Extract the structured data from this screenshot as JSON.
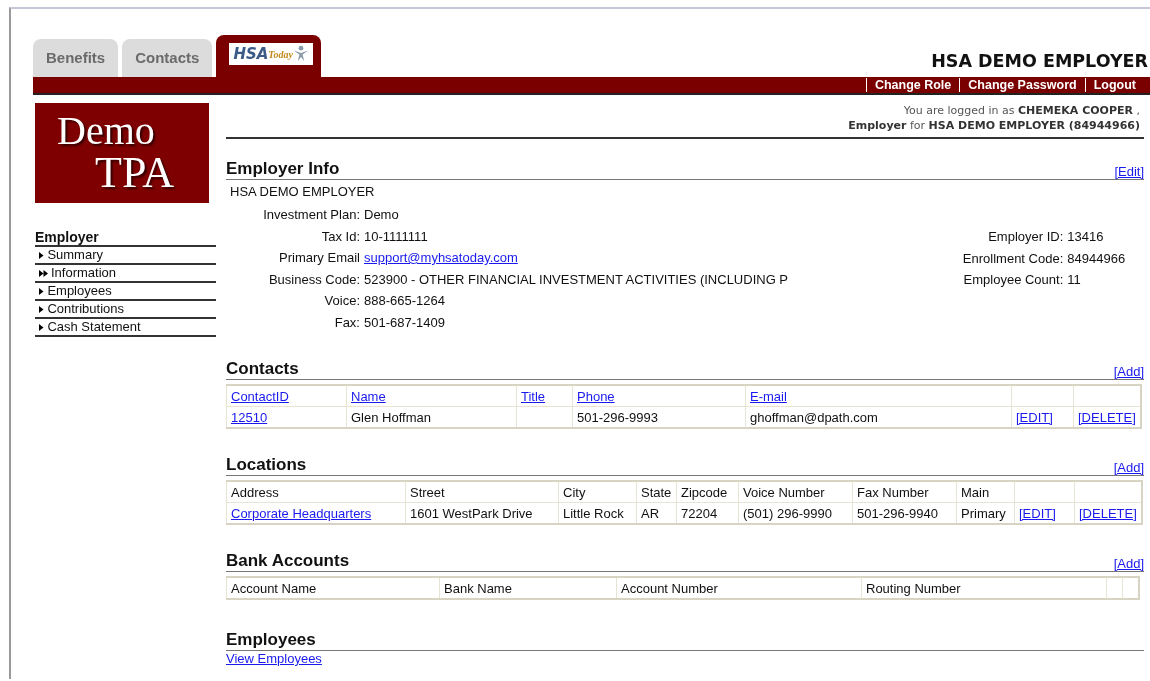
{
  "tabs": [
    {
      "kind": "text",
      "label": "Benefits",
      "selected": false
    },
    {
      "kind": "text",
      "label": "Contacts",
      "selected": false
    },
    {
      "kind": "logo",
      "label": "HSA",
      "sub": "Today",
      "selected": true
    }
  ],
  "employer_title": "HSA DEMO EMPLOYER",
  "top_links": [
    "Change Role",
    "Change Password",
    "Logout"
  ],
  "login_info": [
    "You are logged in as **CHEMEKA  COOPER** ,",
    "**Employer** for **HSA DEMO EMPLOYER (84944966)**"
  ],
  "brand_logo": [
    "Demo",
    "TPA"
  ],
  "sidebar": {
    "title": "Employer",
    "items": [
      {
        "label": "Summary",
        "selected": false
      },
      {
        "label": "Information",
        "selected": true
      },
      {
        "label": "Employees",
        "selected": false
      },
      {
        "label": "Contributions",
        "selected": false
      },
      {
        "label": "Cash Statement",
        "selected": false
      }
    ]
  },
  "employer_info": {
    "title": "Employer Info",
    "action": "[Edit]",
    "name": "HSA DEMO EMPLOYER",
    "left_fields": [
      {
        "label": "Investment Plan:",
        "value": "Demo",
        "link": false
      },
      {
        "label": "Tax Id:",
        "value": "10-1111111",
        "link": false
      },
      {
        "label": "Primary Email",
        "value": "support@myhsatoday.com",
        "link": true
      },
      {
        "label": "Business Code:",
        "value": "523900 - OTHER FINANCIAL INVESTMENT ACTIVITIES (INCLUDING P",
        "link": false
      },
      {
        "label": "Voice:",
        "value": "888-665-1264",
        "link": false
      },
      {
        "label": "Fax:",
        "value": "501-687-1409",
        "link": false
      }
    ],
    "right_fields": [
      {
        "label": "Employer ID:",
        "value": "13416"
      },
      {
        "label": "Enrollment Code:",
        "value": "84944966"
      },
      {
        "label": "Employee Count:",
        "value": "11"
      }
    ]
  },
  "tables": [
    {
      "title": "Contacts",
      "action": "[Add]",
      "columns": [
        {
          "text": "ContactID",
          "link": true
        },
        {
          "text": "Name",
          "link": true
        },
        {
          "text": "Title",
          "link": true
        },
        {
          "text": "Phone",
          "link": true
        },
        {
          "text": "E-mail",
          "link": true
        },
        null,
        null
      ],
      "rows": [
        [
          {
            "text": "12510",
            "link": true
          },
          {
            "text": "Glen Hoffman",
            "link": false
          },
          null,
          {
            "text": "501-296-9993",
            "link": false
          },
          {
            "text": "ghoffman@dpath.com",
            "link": false
          },
          {
            "text": "[EDIT]",
            "link": true
          },
          {
            "text": "[DELETE]",
            "link": true
          }
        ]
      ]
    },
    {
      "title": "Locations",
      "action": "[Add]",
      "columns": [
        {
          "text": "Address",
          "link": false
        },
        {
          "text": "Street",
          "link": false
        },
        {
          "text": "City",
          "link": false
        },
        {
          "text": "State",
          "link": false
        },
        {
          "text": "Zipcode",
          "link": false
        },
        {
          "text": "Voice Number",
          "link": false
        },
        {
          "text": "Fax Number",
          "link": false
        },
        {
          "text": "Main",
          "link": false
        },
        null,
        null
      ],
      "rows": [
        [
          {
            "text": "Corporate Headquarters",
            "link": true
          },
          {
            "text": "1601 WestPark Drive",
            "link": false
          },
          {
            "text": "Little Rock",
            "link": false
          },
          {
            "text": "AR",
            "link": false
          },
          {
            "text": "72204",
            "link": false
          },
          {
            "text": "(501) 296-9990",
            "link": false
          },
          {
            "text": "501-296-9940",
            "link": false
          },
          {
            "text": "Primary",
            "link": false
          },
          {
            "text": "[EDIT]",
            "link": true
          },
          {
            "text": "[DELETE]",
            "link": true
          }
        ]
      ]
    },
    {
      "title": "Bank Accounts",
      "action": "[Add]",
      "columns": [
        {
          "text": "Account Name",
          "link": false
        },
        {
          "text": "Bank Name",
          "link": false
        },
        {
          "text": "Account Number",
          "link": false
        },
        {
          "text": "Routing Number",
          "link": false
        },
        null,
        null
      ]
    }
  ],
  "employees": {
    "title": "Employees",
    "link": "View Employees"
  }
}
